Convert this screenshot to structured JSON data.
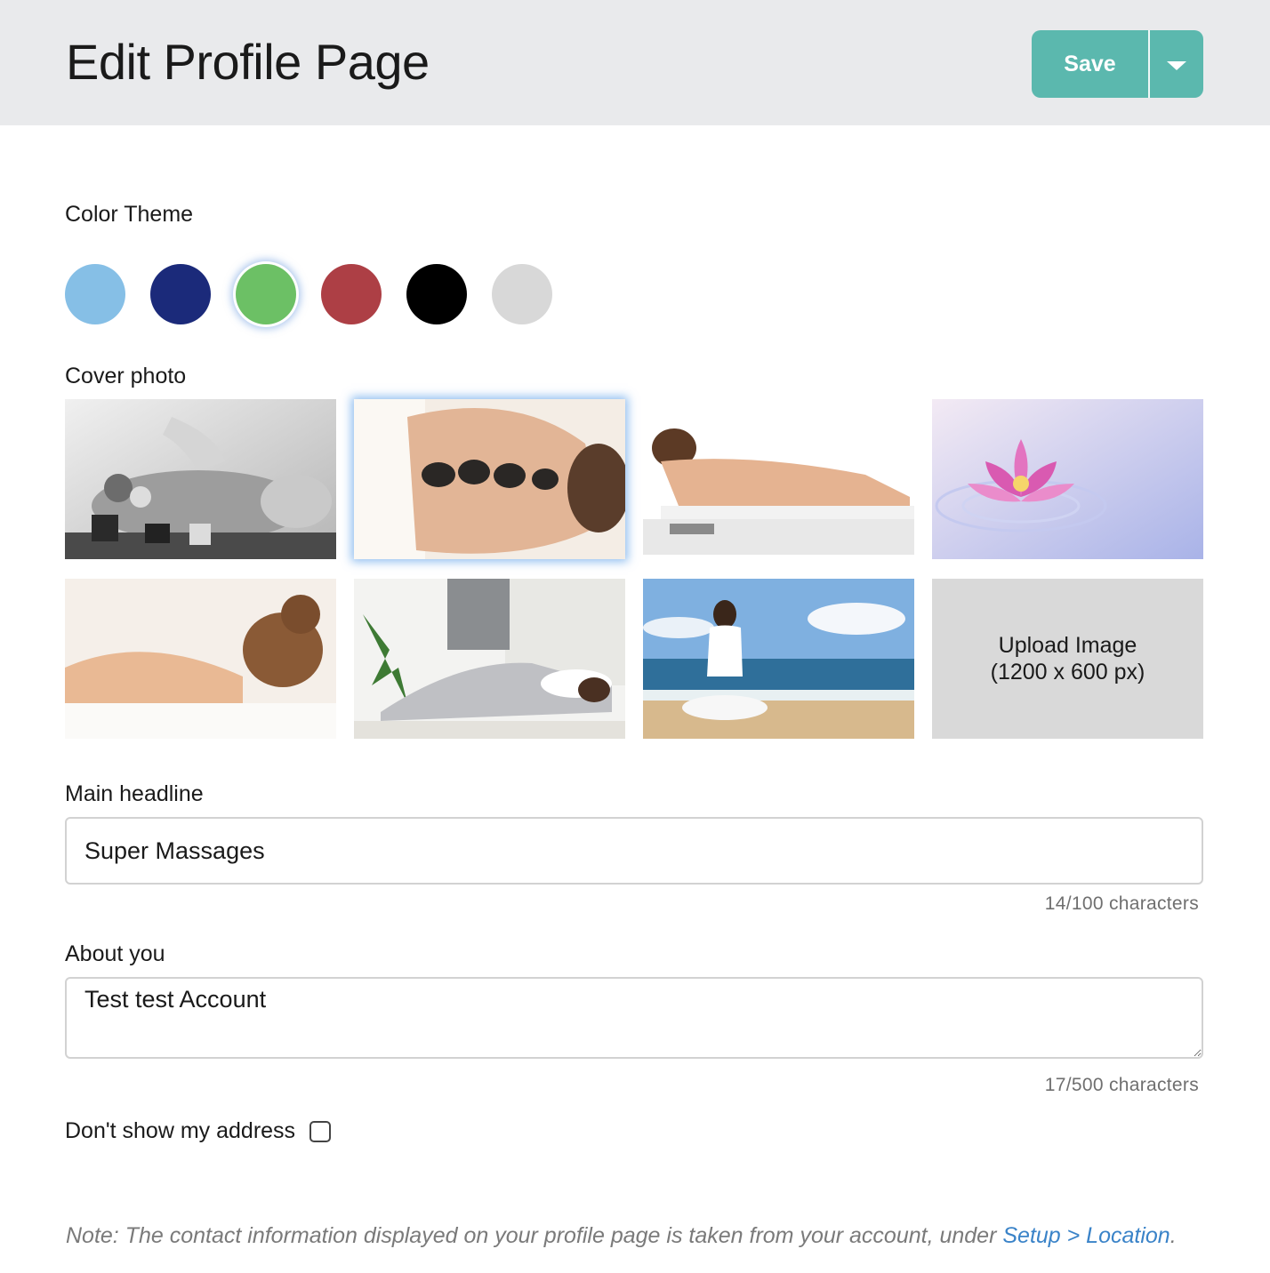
{
  "header": {
    "title": "Edit Profile Page",
    "save_label": "Save",
    "accent_color": "#5bb8ae"
  },
  "color_theme": {
    "label": "Color Theme",
    "swatches": [
      {
        "name": "light-blue",
        "color": "#86bfe6",
        "selected": false
      },
      {
        "name": "navy",
        "color": "#1b2a7a",
        "selected": false
      },
      {
        "name": "green",
        "color": "#6cc065",
        "selected": true
      },
      {
        "name": "red",
        "color": "#ad3f45",
        "selected": false
      },
      {
        "name": "black",
        "color": "#000000",
        "selected": false
      },
      {
        "name": "light-gray",
        "color": "#d8d8d8",
        "selected": false
      }
    ]
  },
  "cover_photo": {
    "label": "Cover photo",
    "photos": [
      {
        "name": "massage-bw",
        "selected": false
      },
      {
        "name": "hot-stones",
        "selected": true
      },
      {
        "name": "massage-table",
        "selected": false
      },
      {
        "name": "lotus-flower",
        "selected": false
      },
      {
        "name": "woman-relaxing",
        "selected": false
      },
      {
        "name": "physio-stretch",
        "selected": false
      },
      {
        "name": "beach-meditation",
        "selected": false
      }
    ],
    "upload_line1": "Upload Image",
    "upload_line2": "(1200 x 600 px)"
  },
  "main_headline": {
    "label": "Main headline",
    "value": "Super Massages",
    "counter": "14/100 characters"
  },
  "about_you": {
    "label": "About you",
    "value": "Test test Account",
    "counter": "17/500 characters"
  },
  "address": {
    "label": "Don't show my address",
    "checked": false
  },
  "note": {
    "text": "Note: The contact information displayed on your profile page is taken from your account, under ",
    "link": "Setup > Location",
    "end": "."
  }
}
